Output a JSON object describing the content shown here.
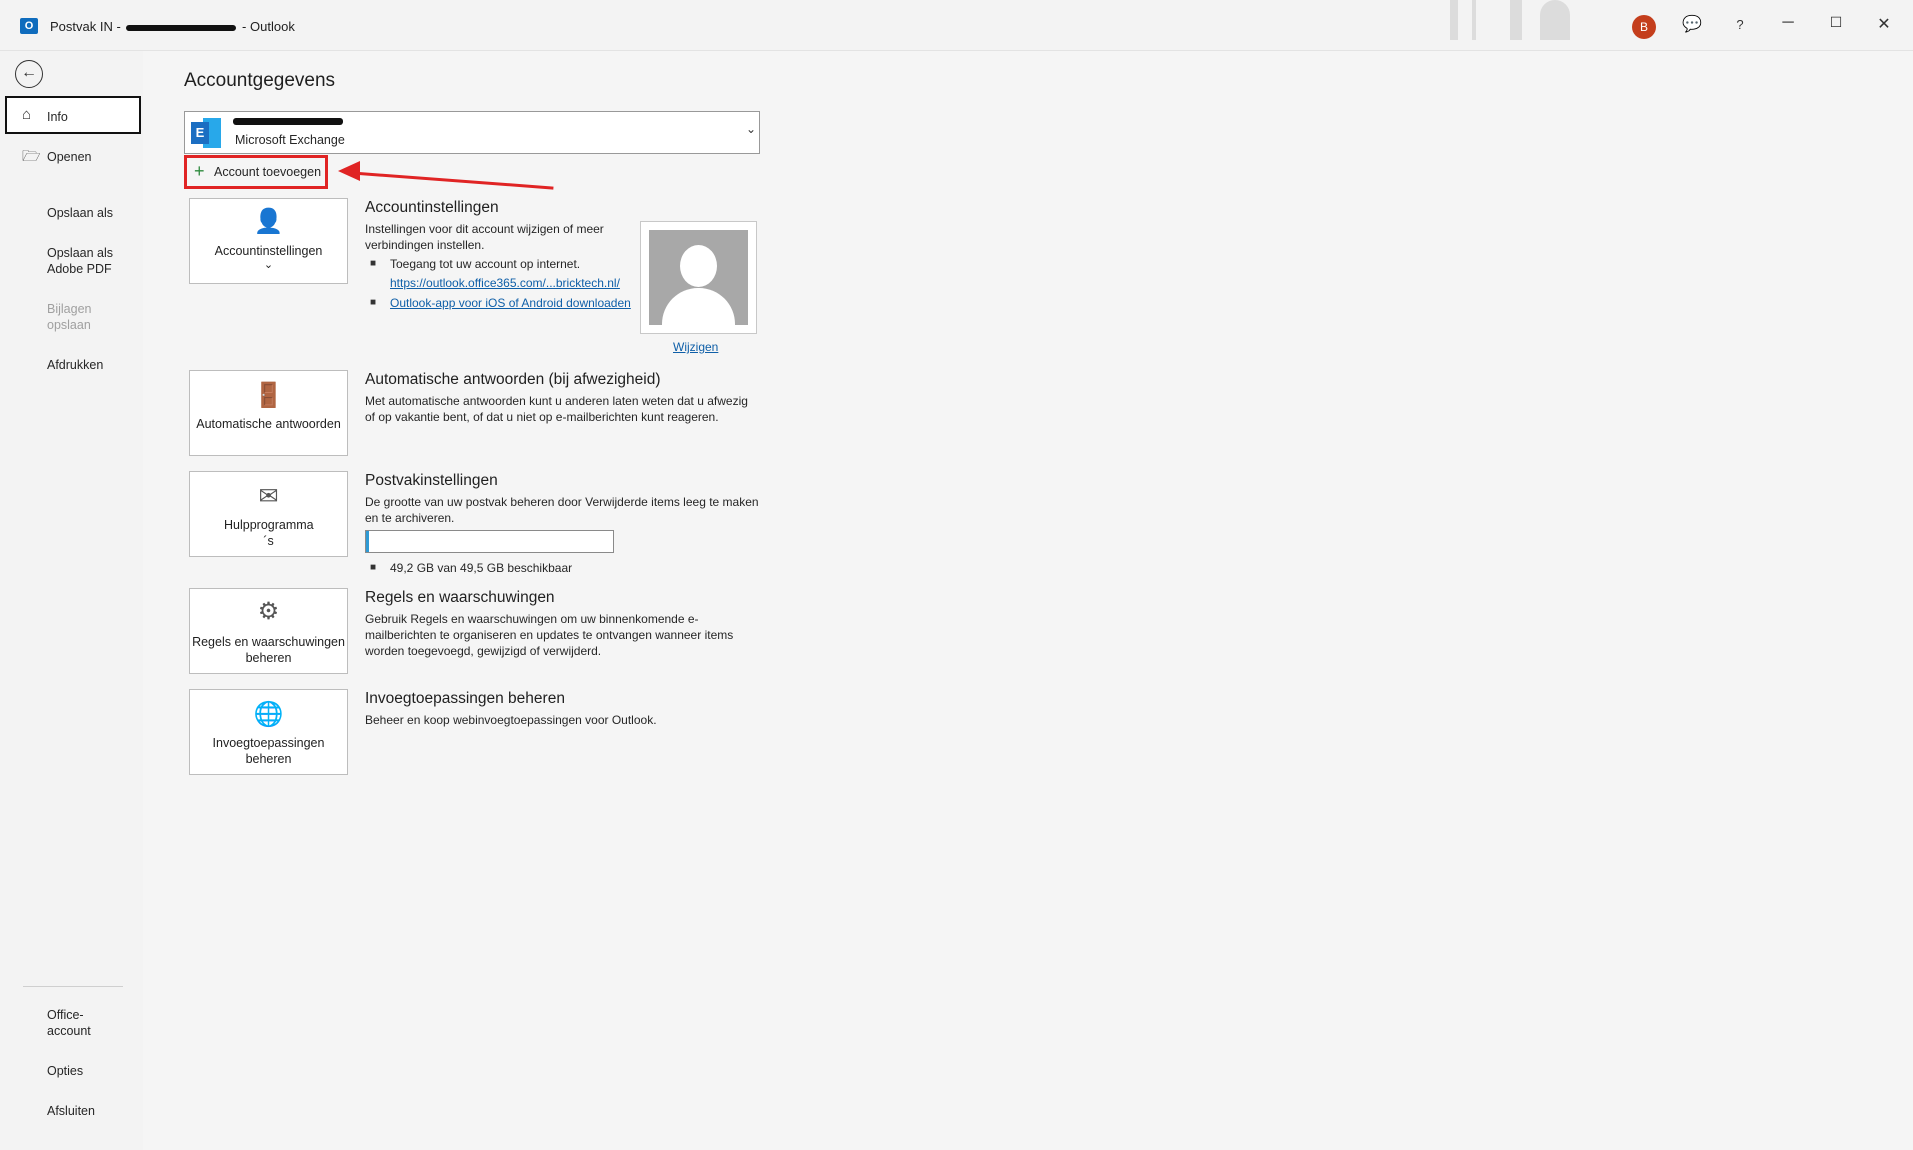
{
  "titlebar": {
    "app_name": "Outlook",
    "title_prefix": "Postvak IN -",
    "separator": "-",
    "user_initial": "B",
    "help": "?",
    "app_icon_letter": "O"
  },
  "sidebar": {
    "items": [
      {
        "label": "Info"
      },
      {
        "label": "Openen"
      },
      {
        "label": "Opslaan als"
      },
      {
        "label": "Opslaan als Adobe PDF"
      },
      {
        "label": "Bijlagen opslaan"
      },
      {
        "label": "Afdrukken"
      },
      {
        "label": "Office-account"
      },
      {
        "label": "Opties"
      },
      {
        "label": "Afsluiten"
      }
    ]
  },
  "main": {
    "heading": "Accountgegevens",
    "account": {
      "type": "Microsoft Exchange"
    },
    "add_account_label": "Account toevoegen",
    "sections": {
      "account_settings": {
        "tile_label": "Accountinstellingen",
        "tile_chevron": "⌄",
        "title": "Accountinstellingen",
        "description": "Instellingen voor dit account wijzigen of meer verbindingen instellen.",
        "bullet1": "Toegang tot uw account op internet.",
        "link1": "https://outlook.office365.com/...bricktech.nl/",
        "link2": "Outlook-app voor iOS of Android downloaden",
        "photo_change": "Wijzigen"
      },
      "auto_replies": {
        "tile_label": "Automatische antwoorden",
        "title": "Automatische antwoorden (bij afwezigheid)",
        "description": "Met automatische antwoorden kunt u anderen laten weten dat u afwezig of op vakantie bent, of dat u niet op e-mailberichten kunt reageren."
      },
      "mailbox": {
        "tile_label": "Hulpprogramma ´s",
        "title": "Postvakinstellingen",
        "description": "De grootte van uw postvak beheren door Verwijderde items leeg te maken en te archiveren.",
        "storage_text": "49,2 GB van 49,5 GB beschikbaar",
        "used_fraction": 0.006
      },
      "rules": {
        "tile_label": "Regels en waarschuwingen beheren",
        "title": "Regels en waarschuwingen",
        "description": "Gebruik Regels en waarschuwingen om uw binnenkomende e-mailberichten te organiseren en updates te ontvangen wanneer items worden toegevoegd, gewijzigd of verwijderd."
      },
      "addins": {
        "tile_label": "Invoegtoepassingen beheren",
        "title": "Invoegtoepassingen beheren",
        "description": "Beheer en koop webinvoegtoepassingen voor Outlook."
      }
    }
  },
  "colors": {
    "accent": "#0f6cbd",
    "highlight": "#e02424",
    "link": "#0f5fa8",
    "progress": "#2f9ad4"
  }
}
